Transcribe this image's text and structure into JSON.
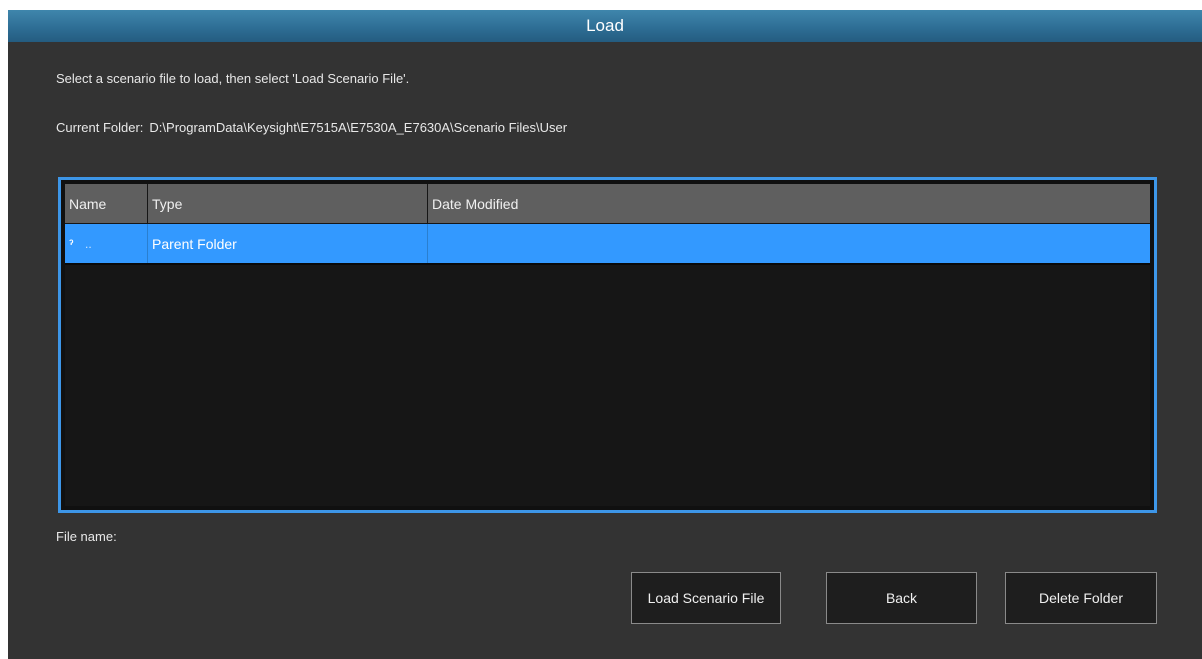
{
  "dialog": {
    "title": "Load",
    "instruction": "Select a scenario file to load, then select 'Load Scenario File'.",
    "current_folder_label": "Current Folder:",
    "current_folder_path": "D:\\ProgramData\\Keysight\\E7515A\\E7530A_E7630A\\Scenario Files\\User",
    "file_name_label": "File name:"
  },
  "table": {
    "columns": [
      "Name",
      "Type",
      "Date Modified"
    ],
    "rows": [
      {
        "name_icon": "up-arrow-icon",
        "name": "..",
        "type": "Parent Folder",
        "date_modified": "",
        "selected": true
      }
    ]
  },
  "buttons": {
    "load": "Load Scenario File",
    "back": "Back",
    "delete": "Delete Folder"
  },
  "colors": {
    "title_bar": "#2e6e95",
    "background": "#333333",
    "table_border": "#3d96e8",
    "selected_row": "#3399ff",
    "header_row": "#5f5f5f"
  }
}
